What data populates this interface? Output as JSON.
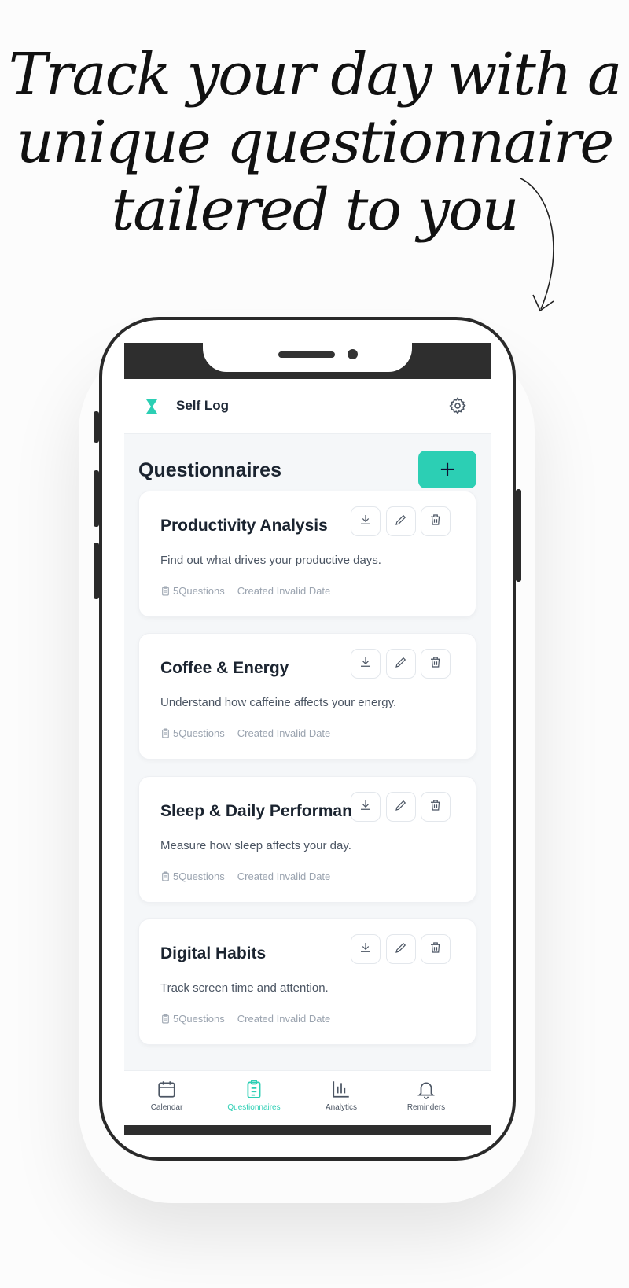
{
  "headline": {
    "line1": "Track your day with a",
    "line2": "unique questionnaire",
    "line3": "tailered to you"
  },
  "app": {
    "title": "Self Log",
    "logo_icon": "hourglass-icon",
    "settings_icon": "gear-icon"
  },
  "page": {
    "title": "Questionnaires",
    "add_label": "+"
  },
  "colors": {
    "accent": "#2ccfb4",
    "text": "#1b2430",
    "muted": "#9aa3af"
  },
  "questionnaires": [
    {
      "title": "Productivity Analysis",
      "description": "Find out what drives your productive days.",
      "questions": "5Questions",
      "created": "Created Invalid Date"
    },
    {
      "title": "Coffee & Energy",
      "description": "Understand how caffeine affects your energy.",
      "questions": "5Questions",
      "created": "Created Invalid Date"
    },
    {
      "title": "Sleep & Daily Performance",
      "description": "Measure how sleep affects your day.",
      "questions": "5Questions",
      "created": "Created Invalid Date"
    },
    {
      "title": "Digital Habits",
      "description": "Track screen time and attention.",
      "questions": "5Questions",
      "created": "Created Invalid Date"
    }
  ],
  "nav": [
    {
      "label": "Calendar",
      "icon": "calendar-icon",
      "active": false
    },
    {
      "label": "Questionnaires",
      "icon": "clipboard-icon",
      "active": true
    },
    {
      "label": "Analytics",
      "icon": "bar-chart-icon",
      "active": false
    },
    {
      "label": "Reminders",
      "icon": "bell-icon",
      "active": false
    }
  ]
}
